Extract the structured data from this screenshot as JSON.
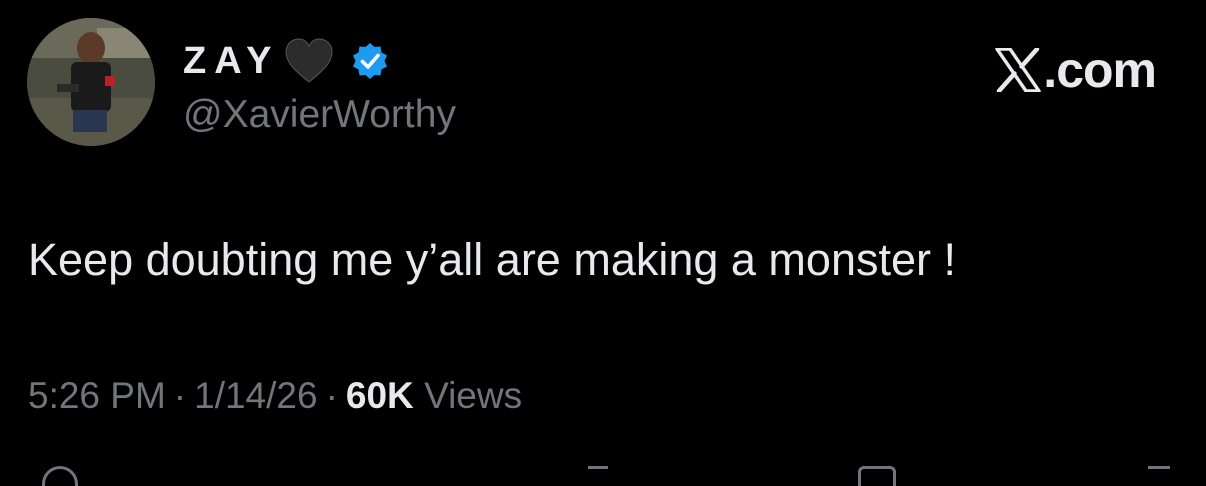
{
  "user": {
    "display_name": "ZAY",
    "handle": "@XavierWorthy",
    "emoji": "black-heart",
    "verified": true
  },
  "brand": {
    "text": ".com",
    "logo": "x-logo-icon"
  },
  "tweet": {
    "text": "Keep doubting me y’all are making a monster !",
    "time": "5:26 PM",
    "date": "1/14/26",
    "views_count": "60K",
    "views_label": "Views"
  },
  "colors": {
    "background": "#000000",
    "text": "#e7e9ea",
    "muted": "#71767b",
    "verified": "#1d9bf0"
  }
}
